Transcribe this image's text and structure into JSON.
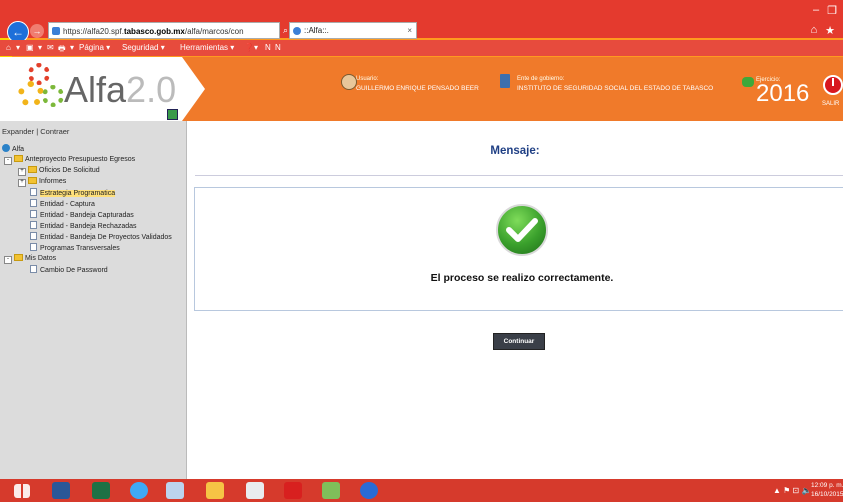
{
  "browser": {
    "url_prefix": "https://alfa20.spf.",
    "url_host": "tabasco.gob.mx",
    "url_path": "/alfa/marcos/con",
    "address_tools": "⌕ ▾ 🔒 ↻",
    "tab_title": "::Alfa::.",
    "tab_close": "×",
    "window_controls": [
      "–",
      "❐"
    ],
    "right_icons": [
      "⌂",
      "★"
    ],
    "cmd_items": [
      "⌂",
      "▾",
      "▣",
      "▾",
      "✉",
      "🖶",
      "▾",
      "Página ▾",
      "Seguridad ▾",
      "Herramientas ▾",
      "❓▾",
      "N",
      "N"
    ]
  },
  "header": {
    "logo_main": "Alfa",
    "logo_version": "2.0",
    "usuario_label": "Usuario:",
    "usuario_value": "GUILLERMO ENRIQUE PENSADO BEER",
    "ente_label": "Ente de gobierno:",
    "ente_value": "INSTITUTO DE SEGURIDAD SOCIAL DEL ESTADO DE TABASCO",
    "ejercicio_label": "Ejercicio:",
    "ejercicio_value": "2016",
    "salir_label": "SALIR"
  },
  "tree": {
    "expand_label": "Expander",
    "separator": " | ",
    "collapse_label": "Contraer",
    "root": "Alfa",
    "expander_minus": "-",
    "expander_plus": "+",
    "nodes": [
      {
        "label": "Anteproyecto Presupuesto Egresos"
      },
      {
        "label": "Oficios De Solicitud"
      },
      {
        "label": "Informes"
      },
      {
        "label": "Estrategia Programatica"
      },
      {
        "label": "Entidad - Captura"
      },
      {
        "label": "Entidad - Bandeja Capturadas"
      },
      {
        "label": "Entidad - Bandeja Rechazadas"
      },
      {
        "label": "Entidad - Bandeja De Proyectos Validados"
      },
      {
        "label": "Programas Transversales"
      },
      {
        "label": "Mis Datos"
      },
      {
        "label": "Cambio De Password"
      }
    ]
  },
  "main": {
    "title": "Mensaje:",
    "message": "El proceso se realizo correctamente.",
    "continue_label": "Continuar"
  },
  "taskbar": {
    "tray": "▲ ⚑ ⊡ 🔈",
    "time": "12:09 p. m.",
    "date": "16/10/2015"
  },
  "colors": {
    "accent_orange": "#f07a2a",
    "chrome_red": "#e43a2e",
    "title_blue": "#1f3f84",
    "success_green": "#3aa02c"
  }
}
